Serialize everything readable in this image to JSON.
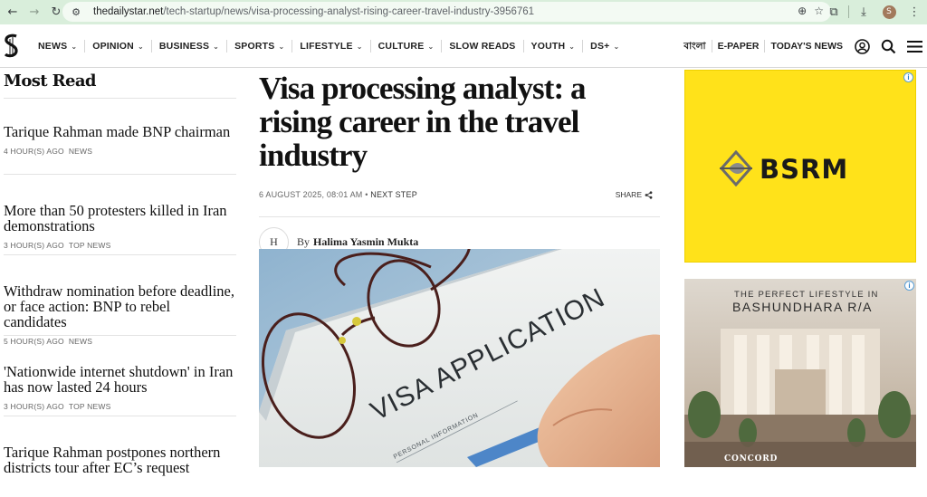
{
  "browser": {
    "url_domain": "thedailystar.net",
    "url_path": "/tech-startup/news/visa-processing-analyst-rising-career-travel-industry-3956761",
    "profile_initial": "S"
  },
  "nav": {
    "items": [
      {
        "label": "NEWS",
        "has_dropdown": true
      },
      {
        "label": "OPINION",
        "has_dropdown": true
      },
      {
        "label": "BUSINESS",
        "has_dropdown": true
      },
      {
        "label": "SPORTS",
        "has_dropdown": true
      },
      {
        "label": "LIFESTYLE",
        "has_dropdown": true
      },
      {
        "label": "CULTURE",
        "has_dropdown": true
      },
      {
        "label": "SLOW READS",
        "has_dropdown": false
      },
      {
        "label": "YOUTH",
        "has_dropdown": true
      },
      {
        "label": "DS+",
        "has_dropdown": true
      }
    ],
    "bangla": "বাংলা",
    "epaper": "E-PAPER",
    "todays_news": "TODAY'S NEWS"
  },
  "most_read": {
    "heading": "Most Read",
    "items": [
      {
        "title": "Tarique Rahman made BNP chairman",
        "time": "4 HOUR(S) AGO",
        "category": "NEWS"
      },
      {
        "title": "More than 50 protesters killed in Iran demonstrations",
        "time": "3 HOUR(S) AGO",
        "category": "TOP NEWS"
      },
      {
        "title": "Withdraw nomination before deadline, or face action: BNP to rebel candidates",
        "time": "5 HOUR(S) AGO",
        "category": "NEWS"
      },
      {
        "title": "'Nationwide internet shutdown' in Iran has now lasted 24 hours",
        "time": "3 HOUR(S) AGO",
        "category": "TOP NEWS"
      },
      {
        "title": "Tarique Rahman postpones northern districts tour after EC’s request",
        "time": "",
        "category": ""
      }
    ]
  },
  "article": {
    "headline": "Visa processing analyst: a rising career in the travel industry",
    "date": "6 AUGUST 2025, 08:01 AM",
    "section": "NEXT STEP",
    "share_label": "SHARE",
    "avatar_initial": "H",
    "by_label": "By",
    "author": "Halima Yasmin Mukta",
    "image_text": "VISA APPLICATION",
    "image_subtext": "PERSONAL INFORMATION"
  },
  "ads": {
    "ad1_brand": "BSRM",
    "ad1_color": "#ffe21a",
    "ad2_line1": "THE PERFECT LIFESTYLE IN",
    "ad2_line2": "BASHUNDHARA R/A",
    "ad2_brand": "CONCORD",
    "adchoices": "i"
  }
}
